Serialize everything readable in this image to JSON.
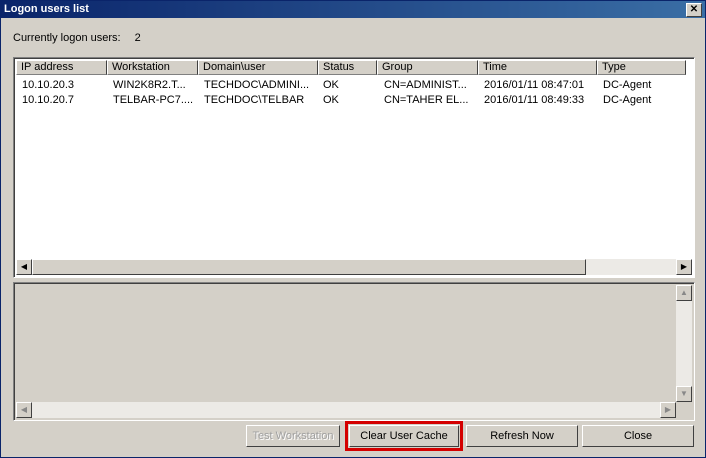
{
  "window": {
    "title": "Logon users list"
  },
  "summary": {
    "label": "Currently logon users:",
    "value": "2"
  },
  "table": {
    "columns": [
      "IP address",
      "Workstation",
      "Domain\\user",
      "Status",
      "Group",
      "Time",
      "Type"
    ],
    "rows": [
      [
        "10.10.20.3",
        "WIN2K8R2.T...",
        "TECHDOC\\ADMINI...",
        "OK",
        "CN=ADMINIST...",
        "2016/01/11 08:47:01",
        "DC-Agent"
      ],
      [
        "10.10.20.7",
        "TELBAR-PC7....",
        "TECHDOC\\TELBAR",
        "OK",
        "CN=TAHER EL...",
        "2016/01/11 08:49:33",
        "DC-Agent"
      ]
    ]
  },
  "buttons": {
    "test_workstation": "Test Workstation",
    "clear_user_cache": "Clear User Cache",
    "refresh_now": "Refresh Now",
    "close": "Close"
  },
  "colors": {
    "highlight": "#d40000",
    "titlebar": "#0a246a"
  }
}
